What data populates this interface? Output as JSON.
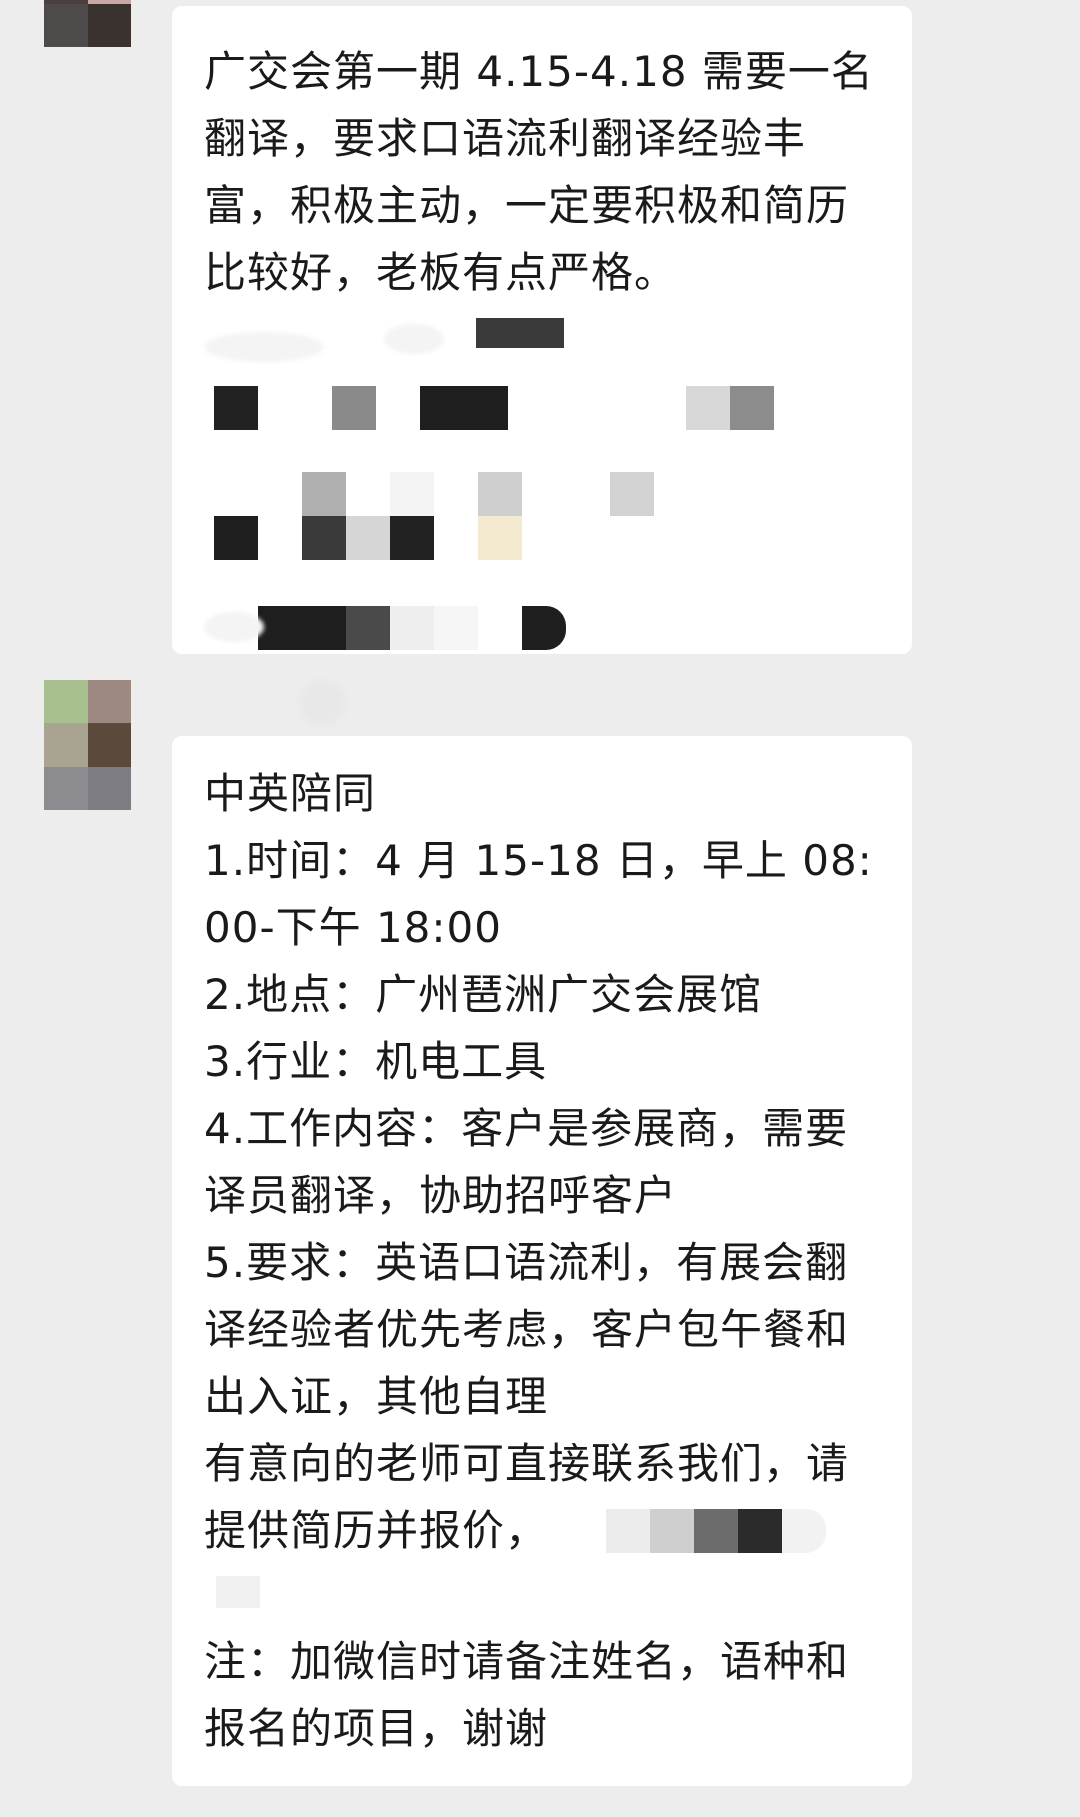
{
  "messages": [
    {
      "lines": [
        "广交会第一期 4.15-4.18 需要一名",
        "翻译，要求口语流利翻译经验丰",
        "富，积极主动，一定要积极和简历",
        "比较好，老板有点严格。"
      ]
    },
    {
      "lines": [
        "中英陪同",
        "1.时间：4 月 15-18 日，早上 08:",
        "00-下午 18:00",
        "2.地点：广州琶洲广交会展馆",
        "3.行业：机电工具",
        "4.工作内容：客户是参展商，需要",
        "译员翻译，协助招呼客户",
        "5.要求：英语口语流利，有展会翻",
        "译经验者优先考虑，客户包午餐和",
        "出入证，其他自理",
        "有意向的老师可直接联系我们，请",
        "提供简历并报价，"
      ],
      "note_lines": [
        "注：加微信时请备注姓名，语种和",
        "报名的项目，谢谢"
      ]
    }
  ],
  "colors": {
    "background": "#ededed",
    "bubble": "#ffffff",
    "text": "#1a1a1a"
  }
}
